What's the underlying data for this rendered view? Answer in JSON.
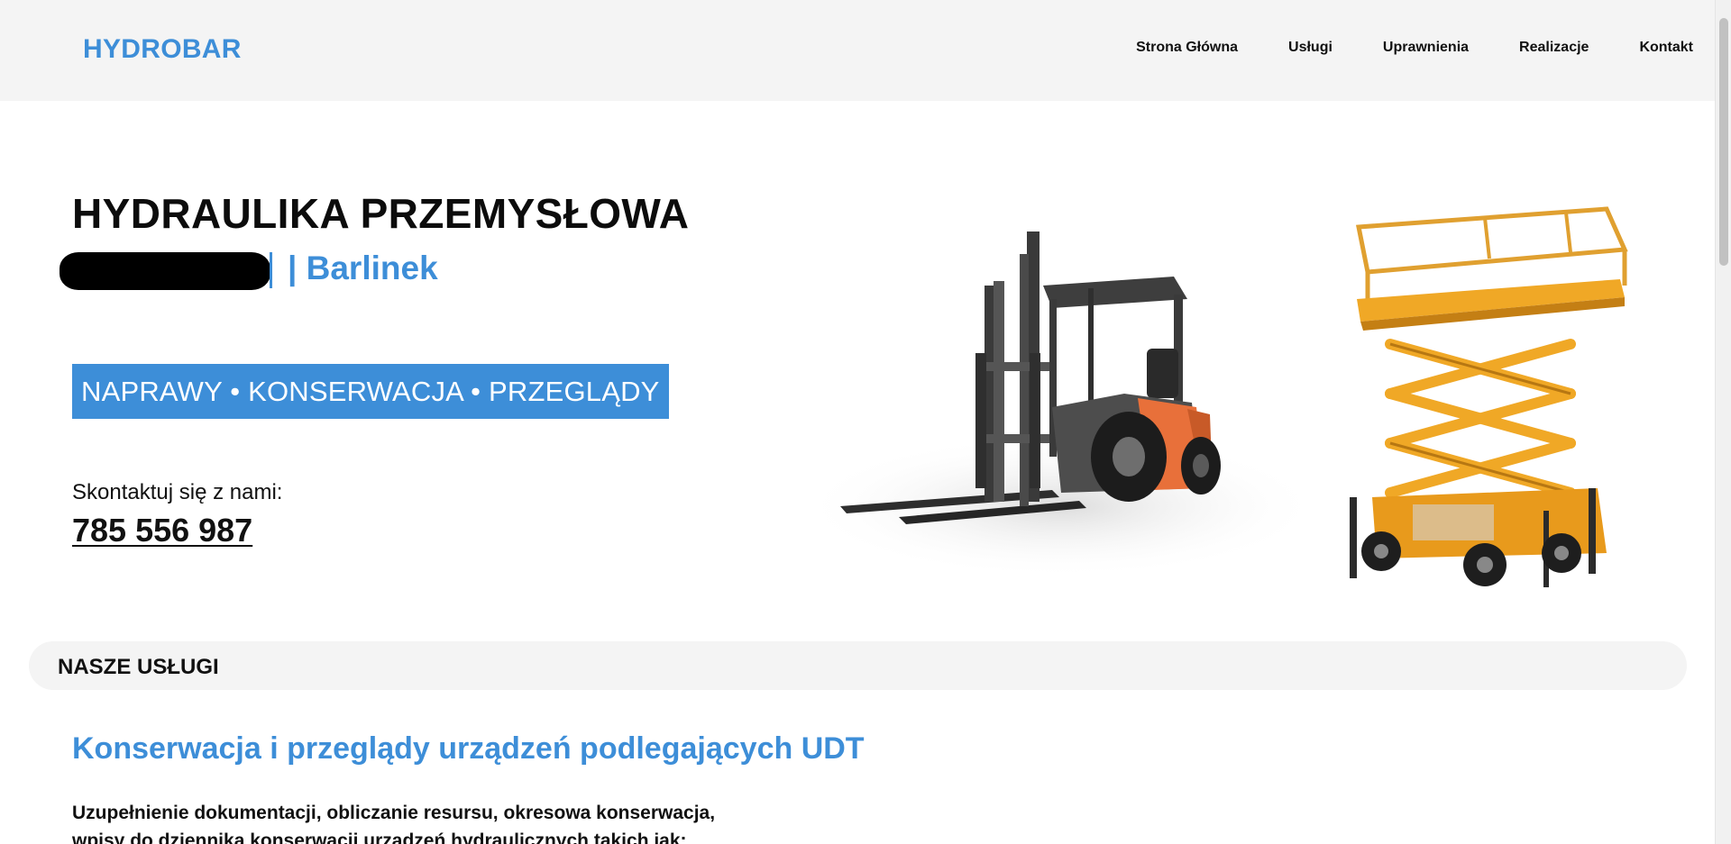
{
  "header": {
    "logo": "HYDROBAR",
    "nav": [
      "Strona Główna",
      "Usługi",
      "Uprawnienia",
      "Realizacje",
      "Kontakt"
    ]
  },
  "hero": {
    "title": "HYDRAULIKA PRZEMYSŁOWA",
    "city": "| Barlinek",
    "tagline": "NAPRAWY • KONSERWACJA • PRZEGLĄDY",
    "contact_label": "Skontaktuj się z nami:",
    "phone": "785 556 987"
  },
  "services": {
    "bar_title": "NASZE USŁUGI",
    "heading": "Konserwacja i przeglądy urządzeń podlegających UDT",
    "description_line1": "Uzupełnienie dokumentacji, obliczanie resursu, okresowa konserwacja,",
    "description_line2": "wpisy do dziennika konserwacji urządzeń hydraulicznych takich jak:"
  },
  "colors": {
    "accent": "#3d8ed8",
    "header_bg": "#f4f4f4",
    "forklift_orange": "#e8703a",
    "lift_yellow": "#f0a826"
  },
  "icons": [
    "forklift-image",
    "scissor-lift-image"
  ]
}
